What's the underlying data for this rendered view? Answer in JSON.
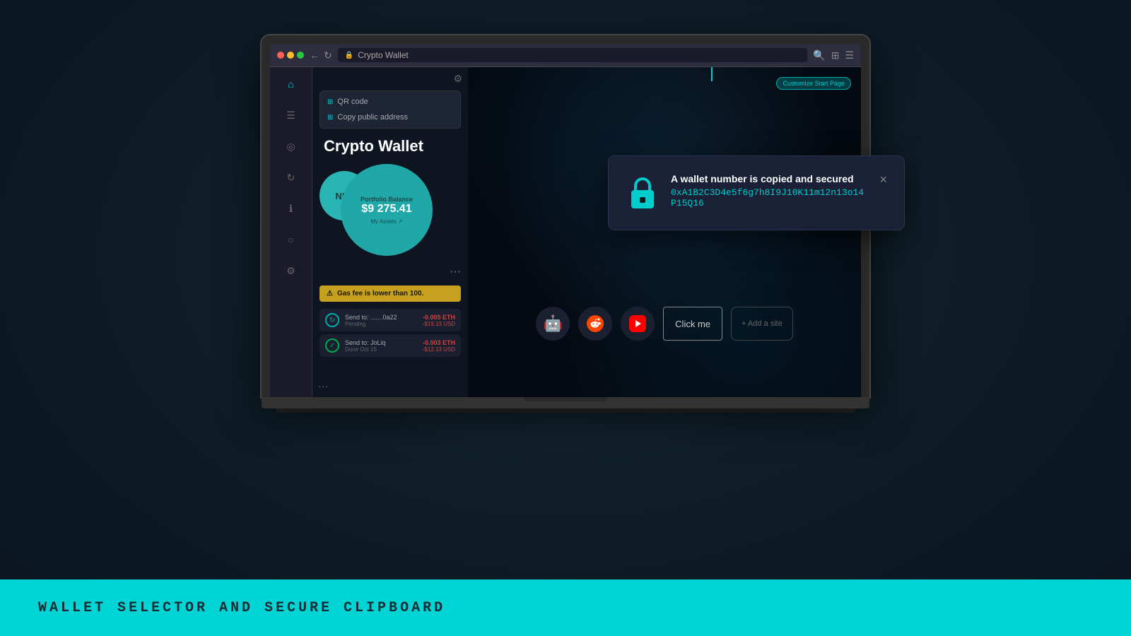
{
  "background": {
    "color": "#1a2a35"
  },
  "bottom_banner": {
    "text": "WALLET SELECTOR AND SECURE CLIPBOARD",
    "bg_color": "#00d4d4"
  },
  "browser": {
    "title": "Crypto Wallet",
    "address": "Crypto Wallet",
    "tab_label": "Crypto Wallet"
  },
  "wallet": {
    "title": "Crypto Wallet",
    "dropdown": {
      "items": [
        {
          "icon": "⊞",
          "label": "QR code"
        },
        {
          "icon": "⊞",
          "label": "Copy public address"
        }
      ]
    },
    "portfolio": {
      "label": "Portfolio Balance",
      "value": "$9 275.41",
      "assets_link": "My Assets"
    },
    "nft_label": "NFT",
    "warning": "Gas fee is lower than 100.",
    "transactions": [
      {
        "to": "Send to: .......0a22",
        "status": "Pending",
        "eth": "-0.005 ETH",
        "usd": "-$19.13 USD",
        "done": false
      },
      {
        "to": "Send to: JoLiq",
        "status": "Done Oct 15",
        "eth": "-0.003 ETH",
        "usd": "-$12.13 USD",
        "done": true
      }
    ]
  },
  "new_tab": {
    "bookmarks": [
      {
        "icon": "🤖",
        "label": ""
      },
      {
        "icon": "▶",
        "label": "",
        "type": "reddit"
      },
      {
        "icon": "▶",
        "label": "",
        "type": "youtube"
      }
    ],
    "click_me_btn": "Click me",
    "add_site_btn": "+ Add a site",
    "customize_btn": "Customize Start Page"
  },
  "notification": {
    "title": "A wallet number is copied and secured",
    "address": "0xA1B2C3D4e5f6g7h8I9J10K11m12n13o14P15Q16",
    "close_label": "×"
  }
}
